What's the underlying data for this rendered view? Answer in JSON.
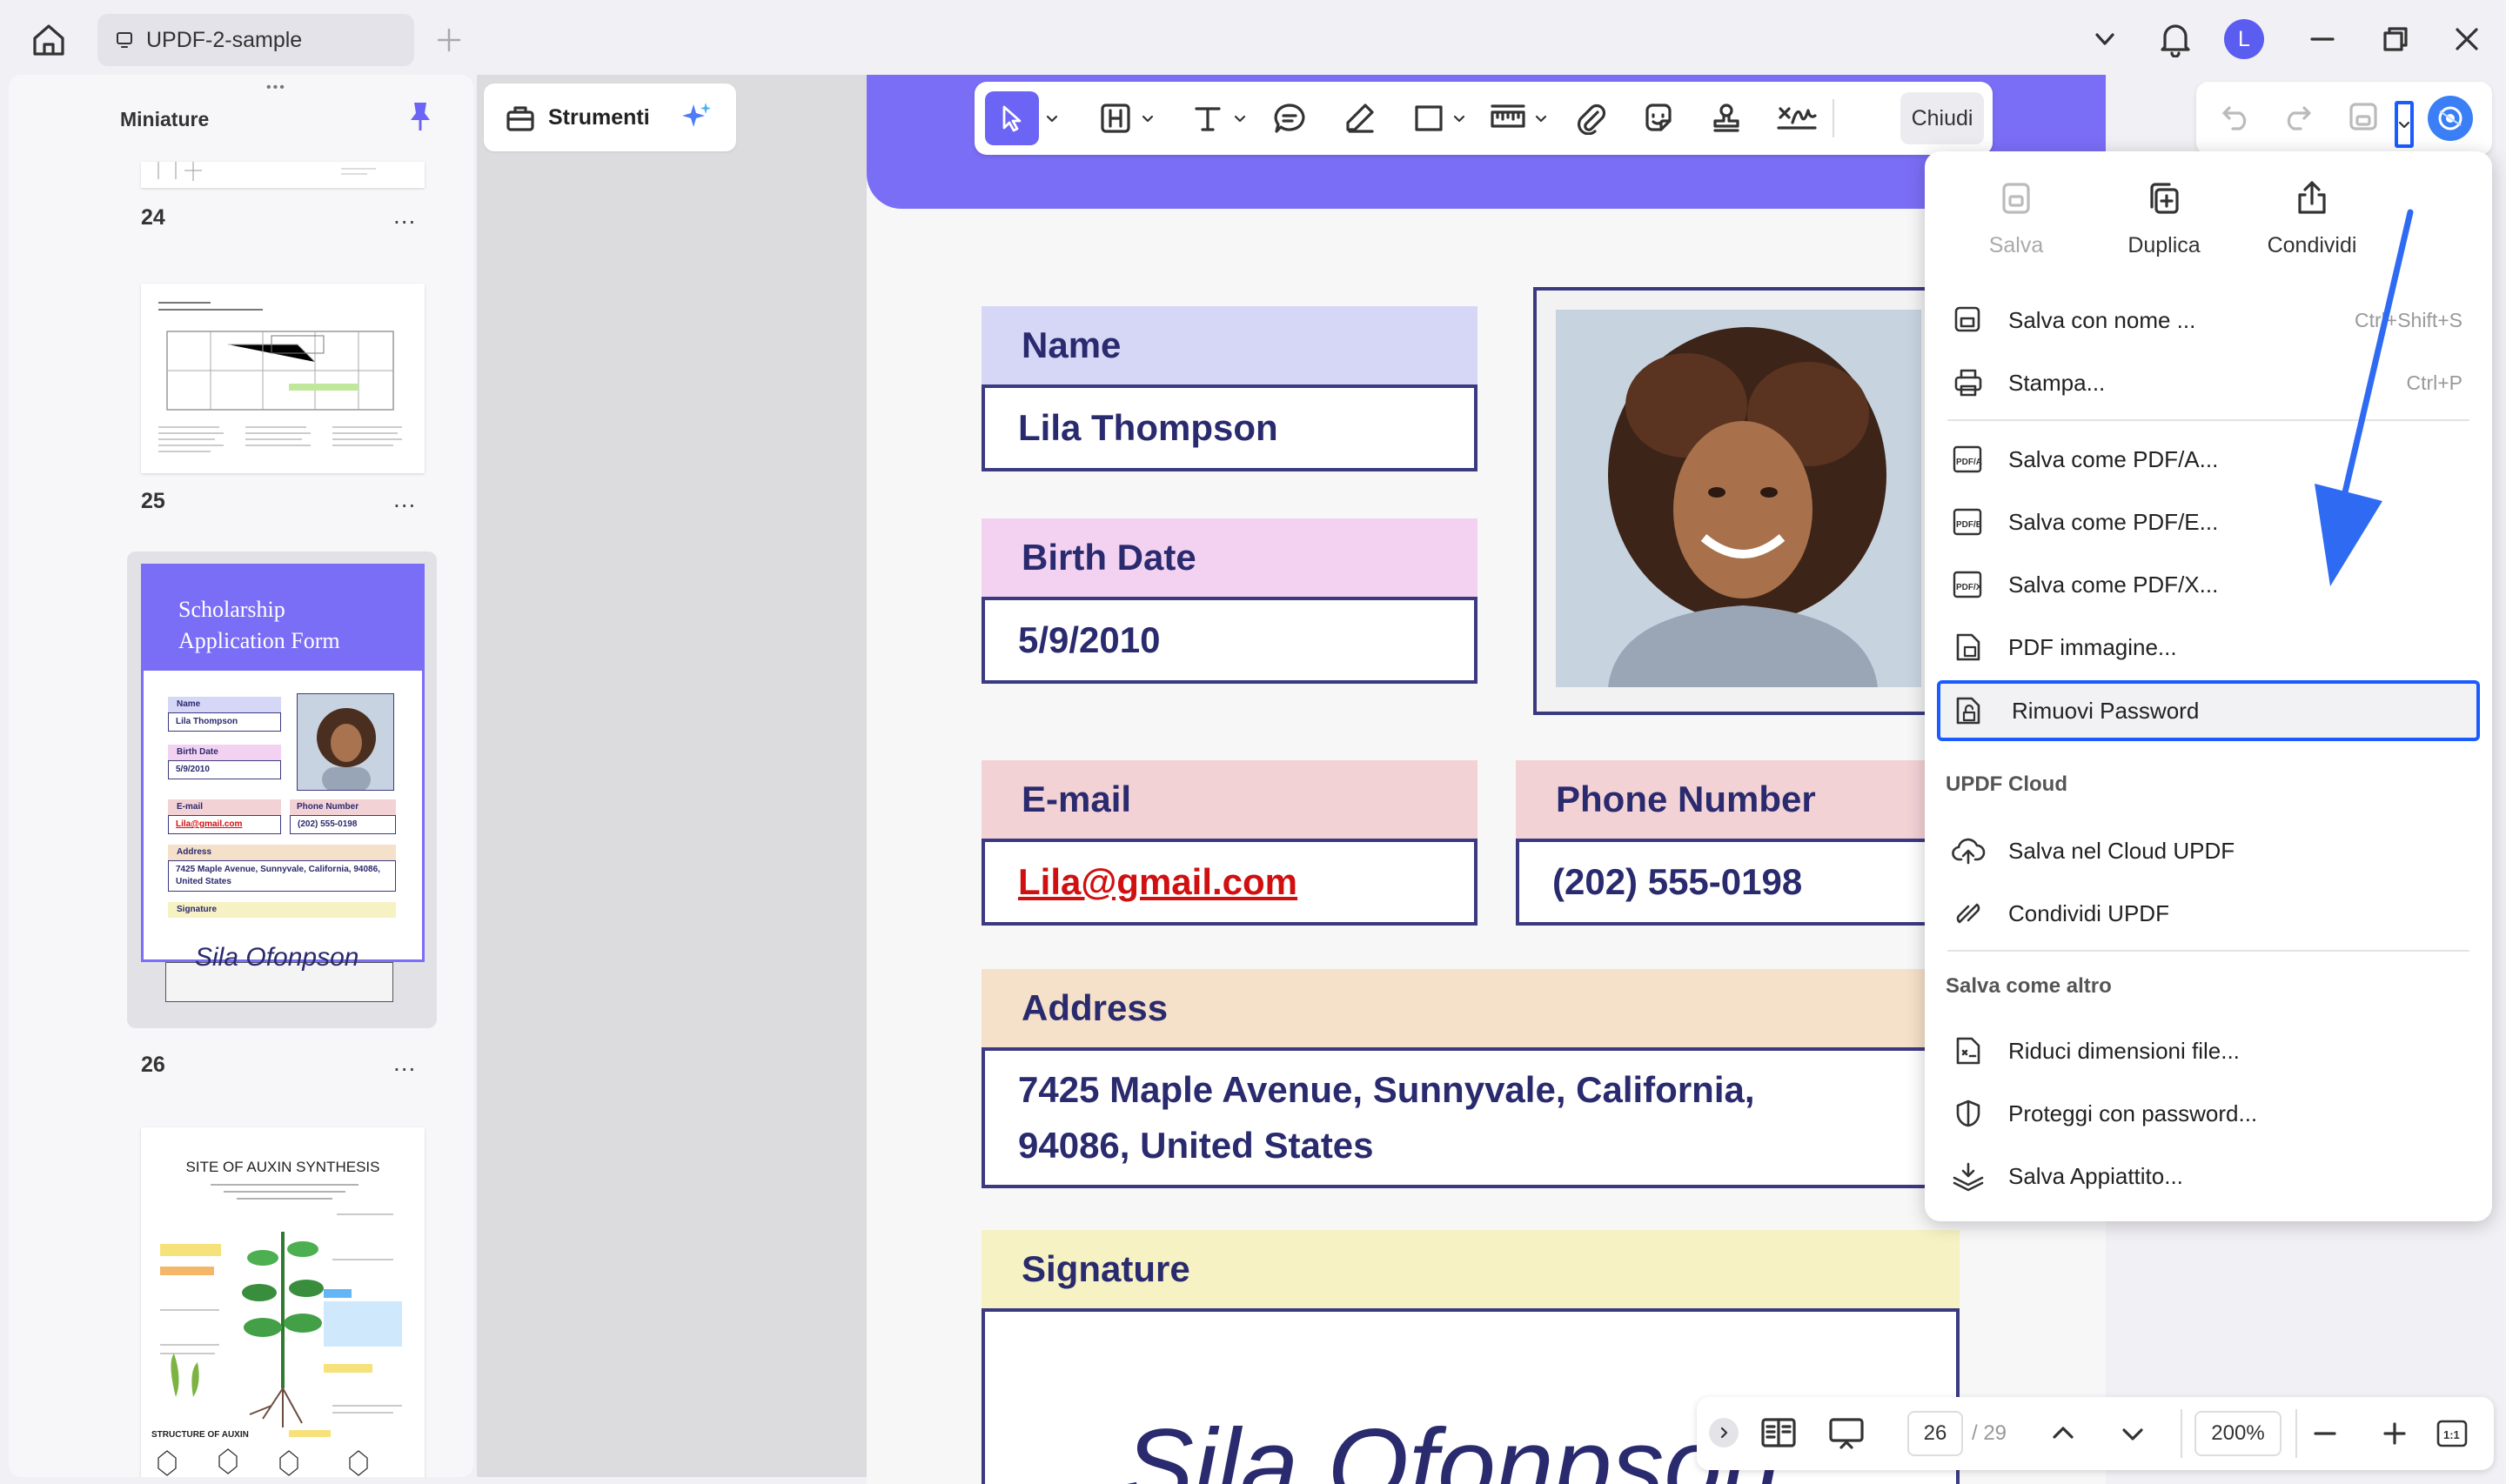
{
  "titlebar": {
    "tab_title": "UPDF-2-sample",
    "avatar_letter": "L"
  },
  "thumbnails": {
    "header": "Miniature",
    "pages": [
      {
        "num": "24"
      },
      {
        "num": "25"
      },
      {
        "num": "26"
      }
    ],
    "more": "...",
    "page26": {
      "title_line1": "Scholarship",
      "title_line2": "Application Form",
      "name_label": "Name",
      "name_value": "Lila Thompson",
      "birth_label": "Birth Date",
      "birth_value": "5/9/2010",
      "email_label": "E-mail",
      "email_value": "Lila@gmail.com",
      "phone_label": "Phone Number",
      "phone_value": "(202) 555-0198",
      "address_label": "Address",
      "address_value": "7425 Maple Avenue, Sunnyvale, California, 94086, United States",
      "signature_label": "Signature",
      "signature_value": "Sila Ofonpson"
    },
    "page27": {
      "title": "SITE OF AUXIN SYNTHESIS",
      "subtitle": "STRUCTURE OF AUXIN"
    }
  },
  "tools_panel": {
    "label": "Strumenti"
  },
  "toolbar": {
    "close_label": "Chiudi"
  },
  "document": {
    "name_label": "Name",
    "name_value": "Lila Thompson",
    "birth_label": "Birth Date",
    "birth_value": "5/9/2010",
    "email_label": "E-mail",
    "email_value": "Lila@gmail.com",
    "phone_label": "Phone Number",
    "phone_value": "(202) 555-0198",
    "address_label": "Address",
    "address_line1": "7425 Maple Avenue, Sunnyvale, California,",
    "address_line2": "94086, United States",
    "signature_label": "Signature",
    "signature_value": "Sila Ofonpson"
  },
  "menu": {
    "top": {
      "save": "Salva",
      "duplicate": "Duplica",
      "share": "Condividi"
    },
    "save_as": {
      "label": "Salva con nome ...",
      "shortcut": "Ctrl+Shift+S"
    },
    "print": {
      "label": "Stampa...",
      "shortcut": "Ctrl+P"
    },
    "pdfa": "Salva come PDF/A...",
    "pdfe": "Salva come PDF/E...",
    "pdfx": "Salva come PDF/X...",
    "pdf_image": "PDF immagine...",
    "remove_password": "Rimuovi Password",
    "cloud_section": "UPDF Cloud",
    "save_cloud": "Salva nel Cloud UPDF",
    "share_updf": "Condividi UPDF",
    "other_section": "Salva come altro",
    "reduce_size": "Riduci dimensioni file...",
    "protect_password": "Proteggi con password...",
    "flatten": "Salva Appiattito..."
  },
  "bottombar": {
    "page_current": "26",
    "page_total": "/ 29",
    "zoom": "200%"
  },
  "colors": {
    "accent": "#6b64f5",
    "highlight": "#1a5cff",
    "banner": "#7b6ef6",
    "text_dark": "#2a2a6e"
  }
}
